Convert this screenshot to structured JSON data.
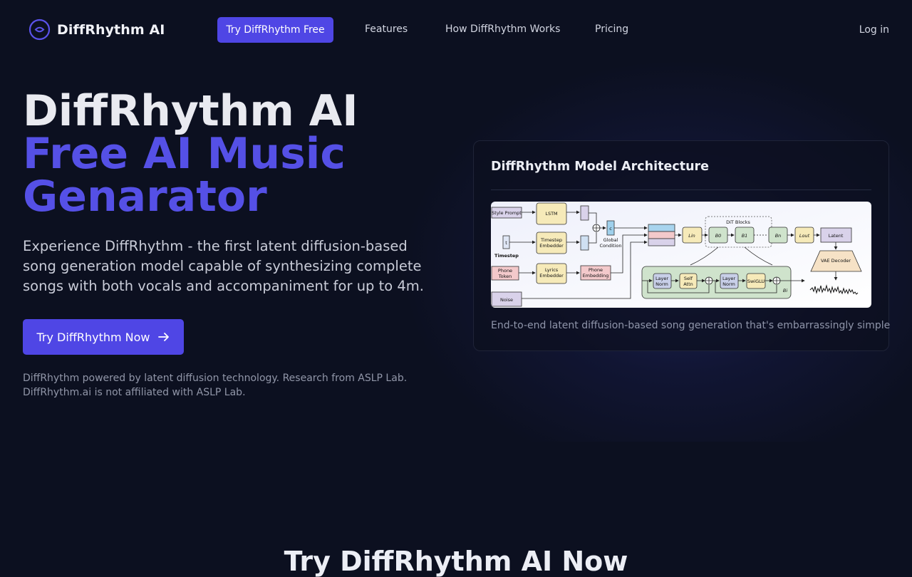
{
  "nav": {
    "brand": "DiffRhythm AI",
    "logo_icon": "circle-logo-icon",
    "cta": "Try DiffRhythm Free",
    "links": [
      "Features",
      "How DiffRhythm Works",
      "Pricing"
    ],
    "login": "Log in"
  },
  "hero": {
    "title_line1": "DiffRhythm AI",
    "title_line2": "Free AI Music",
    "title_line3": "Genarator",
    "description": "Experience DiffRhythm - the first latent diffusion-based song generation model capable of synthesizing complete songs with both vocals and accompaniment for up to 4m.",
    "button": "Try DiffRhythm Now",
    "button_icon": "arrow-right-icon",
    "disclaimer_line1": "DiffRhythm powered by latent diffusion technology. Research from ASLP Lab.",
    "disclaimer_line2": "DiffRhythm.ai is not affiliated with ASLP Lab."
  },
  "card": {
    "title": "DiffRhythm Model Architecture",
    "caption": "End-to-end latent diffusion-based song generation that's embarrassingly simple",
    "diagram": {
      "style_prompt": "Style Prompt",
      "lstm": "LSTM",
      "timestep": "Timestep",
      "t": "t",
      "timestep_embedder_1": "Timestep",
      "timestep_embedder_2": "Embedder",
      "global_condition_1": "Global",
      "global_condition_2": "Condition",
      "c": "c",
      "phone_token_1": "Phone",
      "phone_token_2": "Token",
      "lyrics_embedder_1": "Lyrics",
      "lyrics_embedder_2": "Embedder",
      "phone_embedding_1": "Phone",
      "phone_embedding_2": "Embedding",
      "noise": "Noise",
      "dit_blocks": "DiT Blocks",
      "lin": "Lin",
      "b0": "B0",
      "b1": "B1",
      "bn": "Bn",
      "lout": "Lout",
      "latent": "Latent",
      "vae_decoder": "VAE Decoder",
      "layer_norm_1": "Layer",
      "layer_norm_2": "Norm",
      "self_attn_1": "Self",
      "self_attn_2": "Attn",
      "swiglu": "SwiGLU",
      "bi": "Bi"
    }
  },
  "section": {
    "title": "Try DiffRhythm AI Now"
  },
  "colors": {
    "background": "#0c1020",
    "accent": "#4f46e5",
    "accent_text": "#5550e6"
  }
}
